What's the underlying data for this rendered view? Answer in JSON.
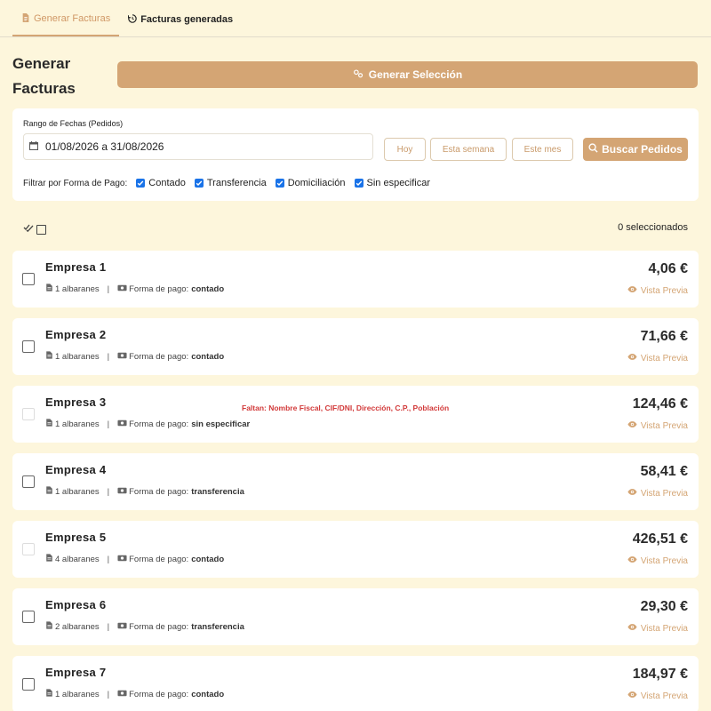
{
  "tabs": [
    {
      "label": "Generar Facturas",
      "active": true,
      "icon": "file-invoice-icon"
    },
    {
      "label": "Facturas generadas",
      "active": false,
      "icon": "history-icon"
    }
  ],
  "header": {
    "title": "Generar Facturas",
    "generate_label": "Generar Selección"
  },
  "filters": {
    "range_label": "Rango de Fechas (Pedidos)",
    "date_range": "01/08/2026 a 31/08/2026",
    "quick_buttons": [
      "Hoy",
      "Esta semana",
      "Este mes"
    ],
    "search_label": "Buscar Pedidos",
    "payment_label": "Filtrar por Forma de Pago:",
    "payment_options": [
      {
        "label": "Contado",
        "checked": true
      },
      {
        "label": "Transferencia",
        "checked": true
      },
      {
        "label": "Domiciliación",
        "checked": true
      },
      {
        "label": "Sin especificar",
        "checked": true
      }
    ]
  },
  "selection": {
    "count_text": "0 seleccionados"
  },
  "labels": {
    "pay_prefix": "Forma de pago:",
    "preview": "Vista Previa"
  },
  "companies": [
    {
      "name": "Empresa 1",
      "albaranes": "1 albaranes",
      "pago": "contado",
      "amount": "4,06 €",
      "disabled": false,
      "warning": ""
    },
    {
      "name": "Empresa 2",
      "albaranes": "1 albaranes",
      "pago": "contado",
      "amount": "71,66 €",
      "disabled": false,
      "warning": ""
    },
    {
      "name": "Empresa 3",
      "albaranes": "1 albaranes",
      "pago": "sin especificar",
      "amount": "124,46 €",
      "disabled": true,
      "warning": "Faltan: Nombre Fiscal, CIF/DNI, Dirección, C.P., Población"
    },
    {
      "name": "Empresa 4",
      "albaranes": "1 albaranes",
      "pago": "transferencia",
      "amount": "58,41 €",
      "disabled": false,
      "warning": ""
    },
    {
      "name": "Empresa 5",
      "albaranes": "4 albaranes",
      "pago": "contado",
      "amount": "426,51 €",
      "disabled": true,
      "warning": ""
    },
    {
      "name": "Empresa 6",
      "albaranes": "2 albaranes",
      "pago": "transferencia",
      "amount": "29,30 €",
      "disabled": false,
      "warning": ""
    },
    {
      "name": "Empresa 7",
      "albaranes": "1 albaranes",
      "pago": "contado",
      "amount": "184,97 €",
      "disabled": false,
      "warning": ""
    }
  ],
  "colors": {
    "accent": "#d4a574",
    "background": "#fdf6dc",
    "warning": "#d23a3a",
    "checkbox": "#1a73e8"
  }
}
